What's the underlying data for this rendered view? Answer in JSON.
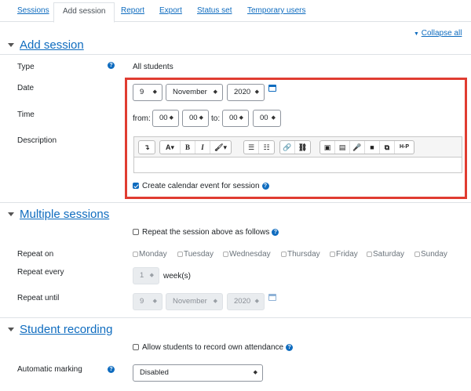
{
  "tabs": [
    "Sessions",
    "Add session",
    "Report",
    "Export",
    "Status set",
    "Temporary users"
  ],
  "collapse_all": "Collapse all",
  "add_session": {
    "title": "Add session",
    "type_label": "Type",
    "type_value": "All students",
    "date_label": "Date",
    "date": {
      "day": "9",
      "month": "November",
      "year": "2020"
    },
    "time_label": "Time",
    "time": {
      "from_label": "from:",
      "from_hour": "00",
      "from_min": "00",
      "to_label": "to:",
      "to_hour": "00",
      "to_min": "00"
    },
    "description_label": "Description",
    "create_event_label": "Create calendar event for session"
  },
  "editor_toolbar": [
    "↴",
    "A▾",
    "B",
    "I",
    "🖌▾",
    "☰",
    "☷",
    "🔗",
    "⛓",
    "▣",
    "▤",
    "🎤",
    "■",
    "⧉",
    "H-P"
  ],
  "multiple": {
    "title": "Multiple sessions",
    "repeat_check_label": "Repeat the session above as follows",
    "repeat_on_label": "Repeat on",
    "days": [
      "Monday",
      "Tuesday",
      "Wednesday",
      "Thursday",
      "Friday",
      "Saturday",
      "Sunday"
    ],
    "repeat_every_label": "Repeat every",
    "repeat_every_value": "1",
    "weeks_label": "week(s)",
    "repeat_until_label": "Repeat until",
    "until": {
      "day": "9",
      "month": "November",
      "year": "2020"
    }
  },
  "student_recording": {
    "title": "Student recording",
    "allow_label": "Allow students to record own attendance",
    "auto_marking_label": "Automatic marking",
    "auto_marking_value": "Disabled"
  },
  "colors": {
    "link": "#0f6cbf",
    "highlight": "#e03c31",
    "help": "#0f6cbf"
  }
}
